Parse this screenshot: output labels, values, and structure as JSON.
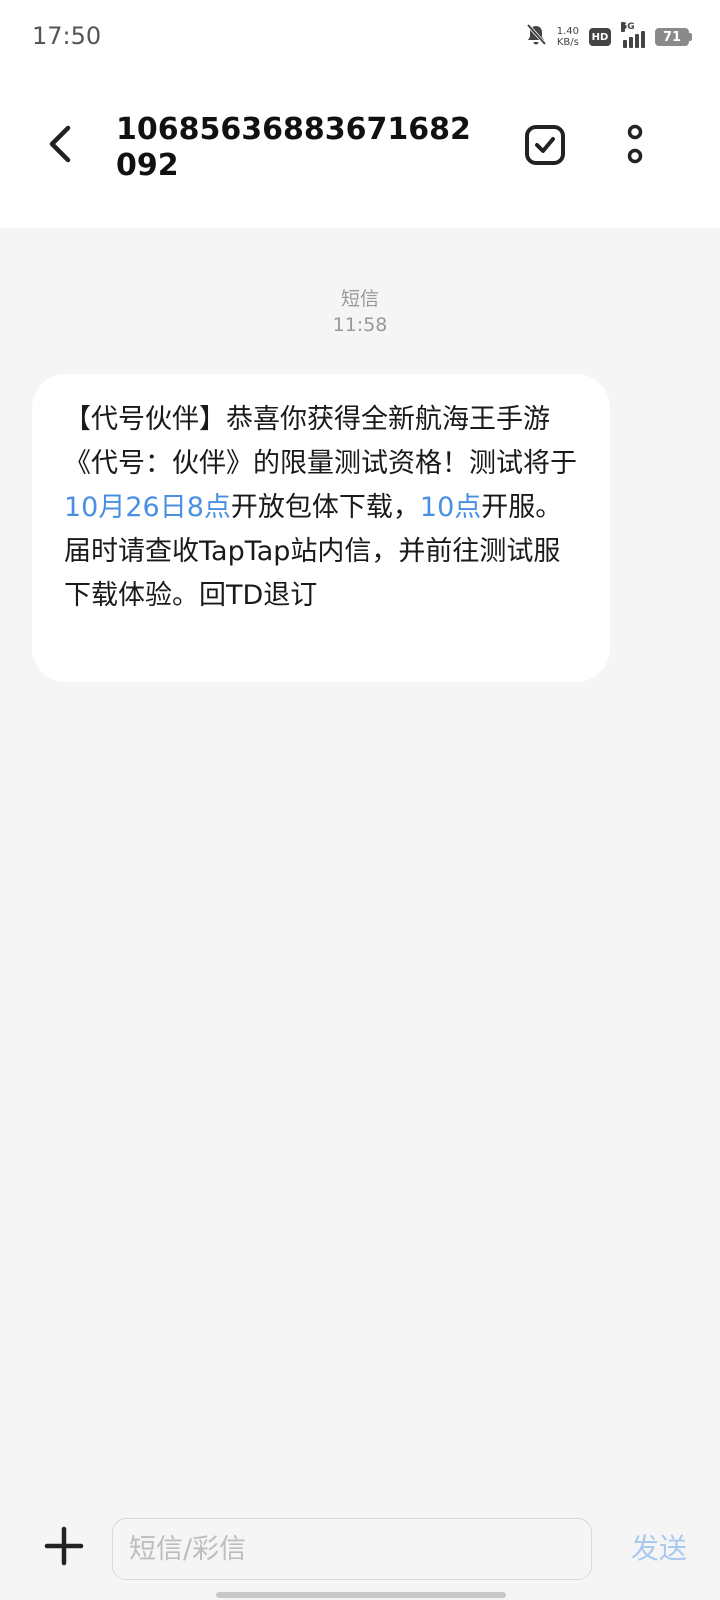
{
  "status_bar": {
    "time": "17:50",
    "net_speed_value": "1.40",
    "net_speed_unit": "KB/s",
    "hd_label": "HD",
    "network_gen": "5G",
    "battery_level": "71",
    "icons": [
      "bell-muted-icon",
      "hd-icon",
      "signal-icon",
      "battery-icon"
    ]
  },
  "header": {
    "title": "10685636883671682092",
    "back_icon": "chevron-left-icon",
    "select_icon": "check-square-icon",
    "more_icon": "more-vertical-icon"
  },
  "conversation": {
    "message_type": "短信",
    "timestamp": "11:58",
    "message": {
      "part1": "【代号伙伴】恭喜你获得全新航海王手游《代号：伙伴》的限量测试资格！测试将于",
      "link1": "10月26日8点",
      "part2": "开放包体下载，",
      "link2": "10点",
      "part3": "开服。届时请查收TapTap站内信，并前往测试服下载体验。回TD退订"
    },
    "highlight_color": "#4a90e2"
  },
  "input_bar": {
    "placeholder": "短信/彩信",
    "send_label": "发送",
    "add_icon": "plus-icon"
  }
}
